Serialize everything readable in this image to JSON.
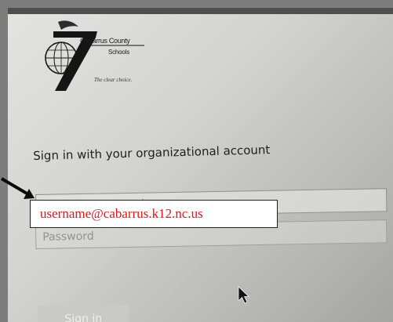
{
  "logo": {
    "name": "Cabarrus County",
    "sub": "Schools",
    "tagline": "The clear choice.",
    "icon": "globe-logo-icon"
  },
  "signin": {
    "heading": "Sign in with your organizational account",
    "email_placeholder": "someone@example.com",
    "password_placeholder": "Password",
    "button_label": "Sign in"
  },
  "annotation": {
    "callout_text": "username@cabarrus.k12.nc.us",
    "callout_color": "#e0151b",
    "arrow_icon": "arrow-right-icon"
  },
  "cursor_icon": "mouse-pointer-icon"
}
